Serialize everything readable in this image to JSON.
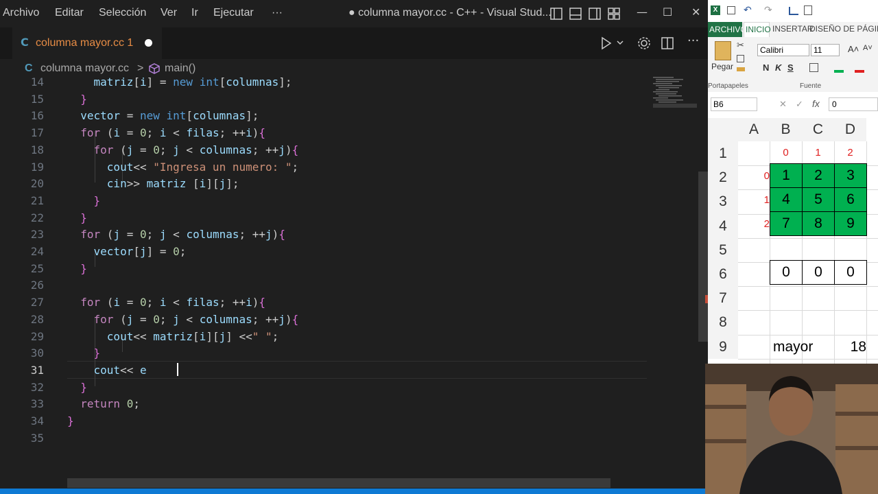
{
  "vscode": {
    "menu": [
      "Archivo",
      "Editar",
      "Selección",
      "Ver",
      "Ir",
      "Ejecutar",
      "···"
    ],
    "window_title": "● columna mayor.cc - C++ - Visual Stud...",
    "window_controls": {
      "minimize": "—",
      "maximize": "☐",
      "close": "✕"
    },
    "tab": {
      "icon": "C",
      "label": "columna mayor.cc 1"
    },
    "breadcrumb": {
      "file": "columna mayor.cc",
      "separator": ">",
      "symbol": "main()"
    },
    "lines": [
      {
        "num": "14",
        "text": "    matriz[i] = new int[columnas];"
      },
      {
        "num": "15",
        "text": "  }"
      },
      {
        "num": "16",
        "text": "  vector = new int[columnas];"
      },
      {
        "num": "17",
        "text": "  for (i = 0; i < filas; ++i){"
      },
      {
        "num": "18",
        "text": "    for (j = 0; j < columnas; ++j){"
      },
      {
        "num": "19",
        "text": "      cout<< \"Ingresa un numero: \";"
      },
      {
        "num": "20",
        "text": "      cin>> matriz [i][j];"
      },
      {
        "num": "21",
        "text": "    }"
      },
      {
        "num": "22",
        "text": "  }"
      },
      {
        "num": "23",
        "text": "  for (j = 0; j < columnas; ++j){"
      },
      {
        "num": "24",
        "text": "    vector[j] = 0;"
      },
      {
        "num": "25",
        "text": "  }"
      },
      {
        "num": "26",
        "text": ""
      },
      {
        "num": "27",
        "text": "  for (i = 0; i < filas; ++i){"
      },
      {
        "num": "28",
        "text": "    for (j = 0; j < columnas; ++j){"
      },
      {
        "num": "29",
        "text": "      cout<< matriz[i][j] <<\" \";"
      },
      {
        "num": "30",
        "text": "    }"
      },
      {
        "num": "31",
        "text": "    cout<< e"
      },
      {
        "num": "32",
        "text": "  }"
      },
      {
        "num": "33",
        "text": "  return 0;"
      },
      {
        "num": "34",
        "text": "}"
      },
      {
        "num": "35",
        "text": ""
      }
    ],
    "active_line": "31"
  },
  "excel": {
    "tabs": [
      "ARCHIVO",
      "INICIO",
      "INSERTAR",
      "DISEÑO DE PÁGIN"
    ],
    "paste_label": "Pegar",
    "font_name": "Calibri",
    "font_size": "11",
    "format_buttons": [
      "N",
      "K",
      "S"
    ],
    "group_labels": {
      "clipboard": "Portapapeles",
      "font": "Fuente"
    },
    "name_box": "B6",
    "formula_value": "0",
    "columns": [
      "A",
      "B",
      "C",
      "D"
    ],
    "rows": [
      "1",
      "2",
      "3",
      "4",
      "5",
      "6",
      "7",
      "8",
      "9"
    ],
    "col_index": [
      "0",
      "1",
      "2"
    ],
    "row_index": [
      "0",
      "1",
      "2"
    ],
    "matrix": [
      [
        "1",
        "2",
        "3"
      ],
      [
        "4",
        "5",
        "6"
      ],
      [
        "7",
        "8",
        "9"
      ]
    ],
    "vector_row": [
      "0",
      "0",
      "0"
    ],
    "mayor_label": "mayor",
    "mayor_value": "18",
    "colors": {
      "matrix_fill": "#00b050",
      "index_text": "#e02020"
    }
  }
}
